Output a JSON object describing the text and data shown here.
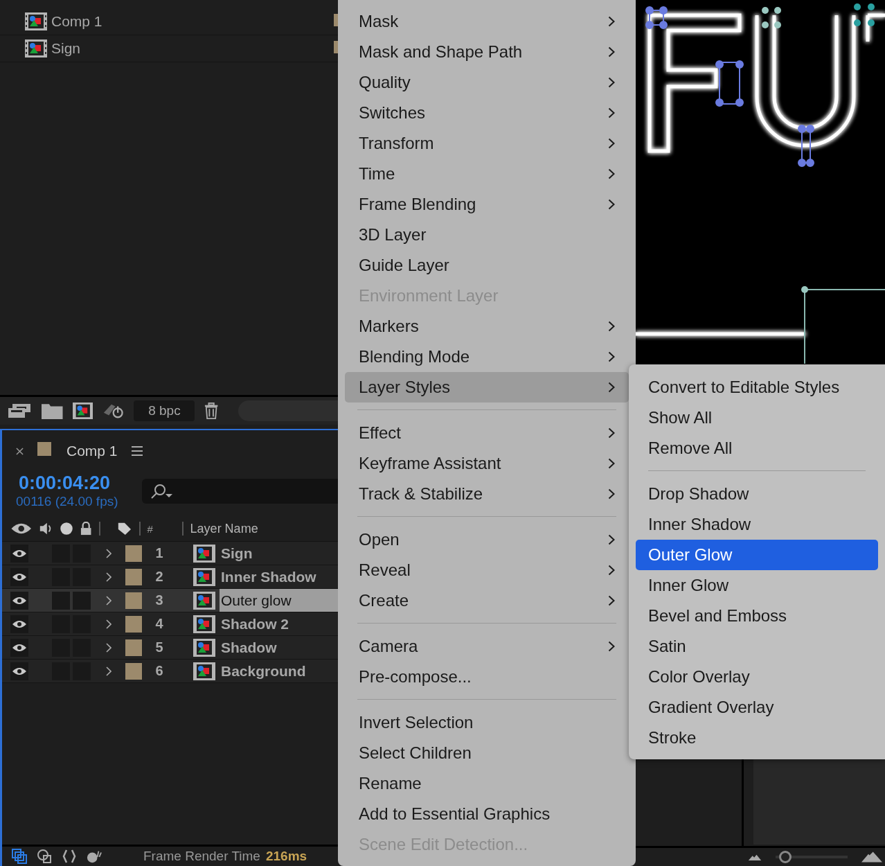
{
  "project_panel": {
    "items": [
      {
        "name": "Comp 1"
      },
      {
        "name": "Sign"
      }
    ]
  },
  "project_toolbar": {
    "bit_depth": "8 bpc"
  },
  "timeline": {
    "tab_title": "Comp 1",
    "timecode": "0:00:04:20",
    "frame_info": "00116 (24.00 fps)",
    "columns": [
      "#",
      "Layer Name"
    ],
    "layers": [
      {
        "number": "1",
        "name": "Sign",
        "visible": true,
        "selected": false
      },
      {
        "number": "2",
        "name": "Inner Shadow",
        "visible": true,
        "selected": false
      },
      {
        "number": "3",
        "name": "Outer glow",
        "visible": true,
        "selected": true
      },
      {
        "number": "4",
        "name": "Shadow 2",
        "visible": true,
        "selected": false
      },
      {
        "number": "5",
        "name": "Shadow",
        "visible": true,
        "selected": false
      },
      {
        "number": "6",
        "name": "Background",
        "visible": true,
        "selected": false
      }
    ]
  },
  "status_bar": {
    "label": "Frame Render Time",
    "value": "216ms"
  },
  "zoom_slider": {
    "level": 0.05
  },
  "context_menu": {
    "groups": [
      [
        {
          "label": "Mask",
          "submenu": true,
          "disabled": false,
          "selected": false
        },
        {
          "label": "Mask and Shape Path",
          "submenu": true,
          "disabled": false,
          "selected": false
        },
        {
          "label": "Quality",
          "submenu": true,
          "disabled": false,
          "selected": false
        },
        {
          "label": "Switches",
          "submenu": true,
          "disabled": false,
          "selected": false
        },
        {
          "label": "Transform",
          "submenu": true,
          "disabled": false,
          "selected": false
        },
        {
          "label": "Time",
          "submenu": true,
          "disabled": false,
          "selected": false
        },
        {
          "label": "Frame Blending",
          "submenu": true,
          "disabled": false,
          "selected": false
        },
        {
          "label": "3D Layer",
          "submenu": false,
          "disabled": false,
          "selected": false
        },
        {
          "label": "Guide Layer",
          "submenu": false,
          "disabled": false,
          "selected": false
        },
        {
          "label": "Environment Layer",
          "submenu": false,
          "disabled": true,
          "selected": false
        },
        {
          "label": "Markers",
          "submenu": true,
          "disabled": false,
          "selected": false
        },
        {
          "label": "Blending Mode",
          "submenu": true,
          "disabled": false,
          "selected": false
        },
        {
          "label": "Layer Styles",
          "submenu": true,
          "disabled": false,
          "selected": true
        }
      ],
      [
        {
          "label": "Effect",
          "submenu": true,
          "disabled": false,
          "selected": false
        },
        {
          "label": "Keyframe Assistant",
          "submenu": true,
          "disabled": false,
          "selected": false
        },
        {
          "label": "Track & Stabilize",
          "submenu": true,
          "disabled": false,
          "selected": false
        }
      ],
      [
        {
          "label": "Open",
          "submenu": true,
          "disabled": false,
          "selected": false
        },
        {
          "label": "Reveal",
          "submenu": true,
          "disabled": false,
          "selected": false
        },
        {
          "label": "Create",
          "submenu": true,
          "disabled": false,
          "selected": false
        }
      ],
      [
        {
          "label": "Camera",
          "submenu": true,
          "disabled": false,
          "selected": false
        },
        {
          "label": "Pre-compose...",
          "submenu": false,
          "disabled": false,
          "selected": false
        }
      ],
      [
        {
          "label": "Invert Selection",
          "submenu": false,
          "disabled": false,
          "selected": false
        },
        {
          "label": "Select Children",
          "submenu": false,
          "disabled": false,
          "selected": false
        },
        {
          "label": "Rename",
          "submenu": false,
          "disabled": false,
          "selected": false
        },
        {
          "label": "Add to Essential Graphics",
          "submenu": false,
          "disabled": false,
          "selected": false
        },
        {
          "label": "Scene Edit Detection...",
          "submenu": false,
          "disabled": true,
          "selected": false
        }
      ]
    ]
  },
  "submenu": {
    "groups": [
      [
        {
          "label": "Convert to Editable Styles",
          "selected": false
        },
        {
          "label": "Show All",
          "selected": false
        },
        {
          "label": "Remove All",
          "selected": false
        }
      ],
      [
        {
          "label": "Drop Shadow",
          "selected": false
        },
        {
          "label": "Inner Shadow",
          "selected": false
        },
        {
          "label": "Outer Glow",
          "selected": true
        },
        {
          "label": "Inner Glow",
          "selected": false
        },
        {
          "label": "Bevel and Emboss",
          "selected": false
        },
        {
          "label": "Satin",
          "selected": false
        },
        {
          "label": "Color Overlay",
          "selected": false
        },
        {
          "label": "Gradient Overlay",
          "selected": false
        },
        {
          "label": "Stroke",
          "selected": false
        }
      ]
    ]
  }
}
